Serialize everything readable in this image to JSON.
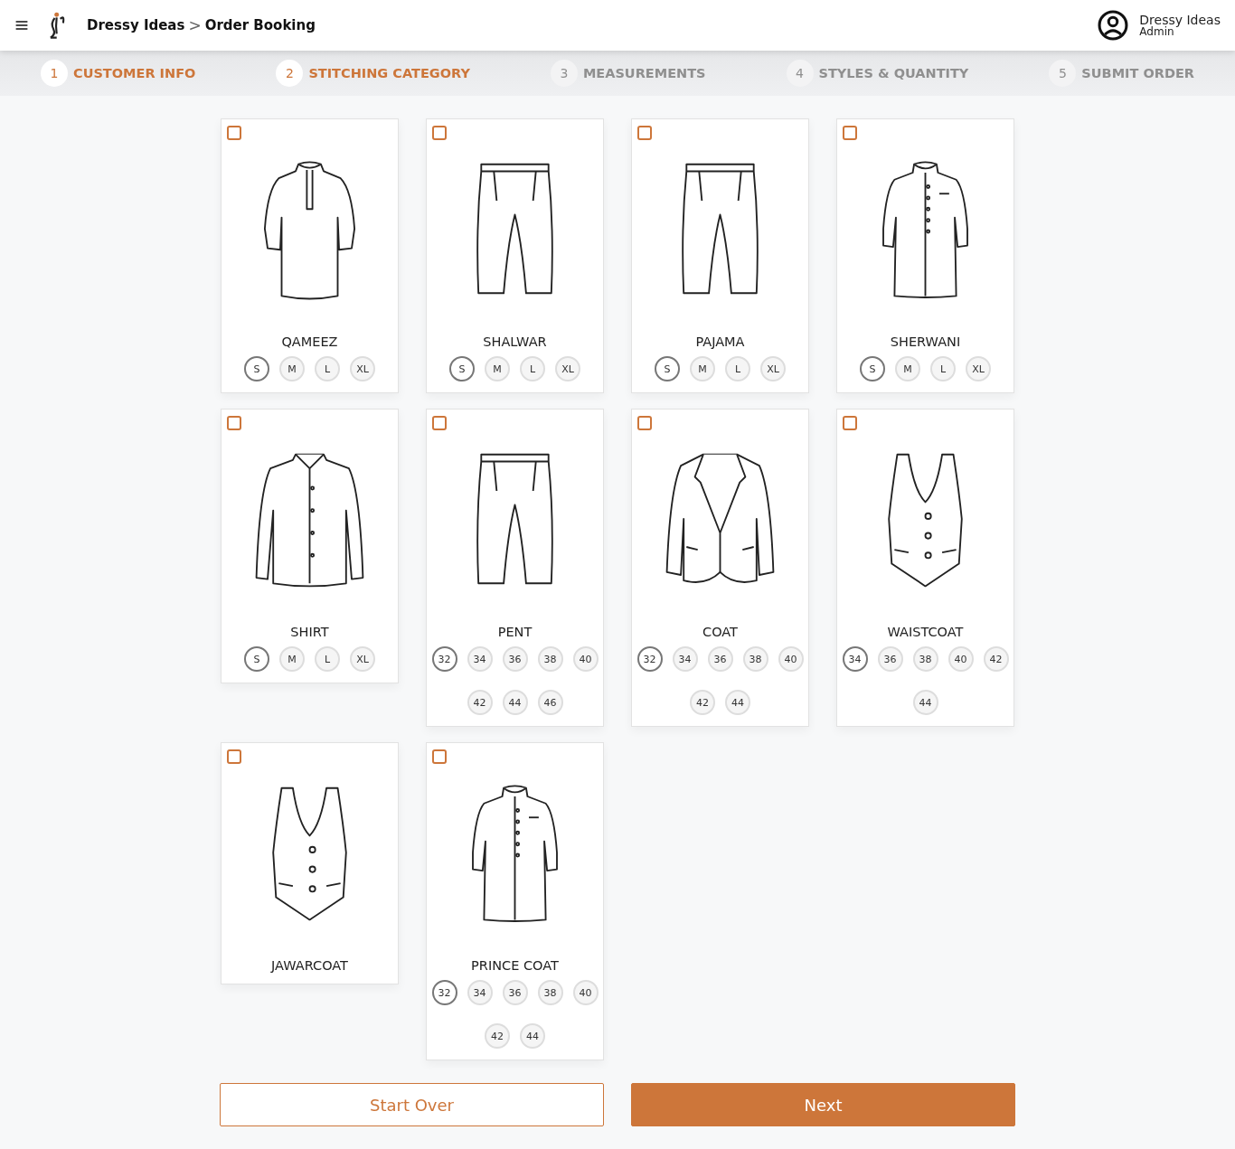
{
  "header": {
    "brand": "Dressy Ideas",
    "separator": ">",
    "page": "Order Booking",
    "user": {
      "name": "Dressy Ideas",
      "role": "Admin"
    }
  },
  "steps": [
    {
      "number": "1",
      "label": "CUSTOMER INFO",
      "active": true
    },
    {
      "number": "2",
      "label": "STITCHING CATEGORY",
      "active": true
    },
    {
      "number": "3",
      "label": "MEASUREMENTS",
      "active": false
    },
    {
      "number": "4",
      "label": "STYLES & QUANTITY",
      "active": false
    },
    {
      "number": "5",
      "label": "SUBMIT ORDER",
      "active": false
    }
  ],
  "garments": [
    {
      "name": "QAMEEZ",
      "kind": "kurta",
      "checked": false,
      "sizes": [
        {
          "label": "S",
          "selected": true
        },
        {
          "label": "M",
          "selected": false
        },
        {
          "label": "L",
          "selected": false
        },
        {
          "label": "XL",
          "selected": false
        }
      ]
    },
    {
      "name": "SHALWAR",
      "kind": "trousers",
      "checked": false,
      "sizes": [
        {
          "label": "S",
          "selected": true
        },
        {
          "label": "M",
          "selected": false
        },
        {
          "label": "L",
          "selected": false
        },
        {
          "label": "XL",
          "selected": false
        }
      ]
    },
    {
      "name": "PAJAMA",
      "kind": "trousers",
      "checked": false,
      "sizes": [
        {
          "label": "S",
          "selected": true
        },
        {
          "label": "M",
          "selected": false
        },
        {
          "label": "L",
          "selected": false
        },
        {
          "label": "XL",
          "selected": false
        }
      ]
    },
    {
      "name": "SHERWANI",
      "kind": "sherwani",
      "checked": false,
      "sizes": [
        {
          "label": "S",
          "selected": true
        },
        {
          "label": "M",
          "selected": false
        },
        {
          "label": "L",
          "selected": false
        },
        {
          "label": "XL",
          "selected": false
        }
      ]
    },
    {
      "name": "SHIRT",
      "kind": "shirt",
      "checked": false,
      "sizes": [
        {
          "label": "S",
          "selected": true
        },
        {
          "label": "M",
          "selected": false
        },
        {
          "label": "L",
          "selected": false
        },
        {
          "label": "XL",
          "selected": false
        }
      ]
    },
    {
      "name": "PENT",
      "kind": "trousers",
      "checked": false,
      "sizes": [
        {
          "label": "32",
          "selected": true
        },
        {
          "label": "34",
          "selected": false
        },
        {
          "label": "36",
          "selected": false
        },
        {
          "label": "38",
          "selected": false
        },
        {
          "label": "40",
          "selected": false
        },
        {
          "label": "42",
          "selected": false
        },
        {
          "label": "44",
          "selected": false
        },
        {
          "label": "46",
          "selected": false
        }
      ]
    },
    {
      "name": "COAT",
      "kind": "coat",
      "checked": false,
      "sizes": [
        {
          "label": "32",
          "selected": true
        },
        {
          "label": "34",
          "selected": false
        },
        {
          "label": "36",
          "selected": false
        },
        {
          "label": "38",
          "selected": false
        },
        {
          "label": "40",
          "selected": false
        },
        {
          "label": "42",
          "selected": false
        },
        {
          "label": "44",
          "selected": false
        }
      ]
    },
    {
      "name": "WAISTCOAT",
      "kind": "vest",
      "checked": false,
      "sizes": [
        {
          "label": "34",
          "selected": true
        },
        {
          "label": "36",
          "selected": false
        },
        {
          "label": "38",
          "selected": false
        },
        {
          "label": "40",
          "selected": false
        },
        {
          "label": "42",
          "selected": false
        },
        {
          "label": "44",
          "selected": false
        }
      ]
    },
    {
      "name": "JAWARCOAT",
      "kind": "vest",
      "checked": false
    },
    {
      "name": "PRINCE COAT",
      "kind": "sherwani",
      "checked": false,
      "sizes": [
        {
          "label": "32",
          "selected": true
        },
        {
          "label": "34",
          "selected": false
        },
        {
          "label": "36",
          "selected": false
        },
        {
          "label": "38",
          "selected": false
        },
        {
          "label": "40",
          "selected": false
        },
        {
          "label": "42",
          "selected": false
        },
        {
          "label": "44",
          "selected": false
        }
      ]
    }
  ],
  "actions": {
    "back": "Start Over",
    "next": "Next"
  }
}
